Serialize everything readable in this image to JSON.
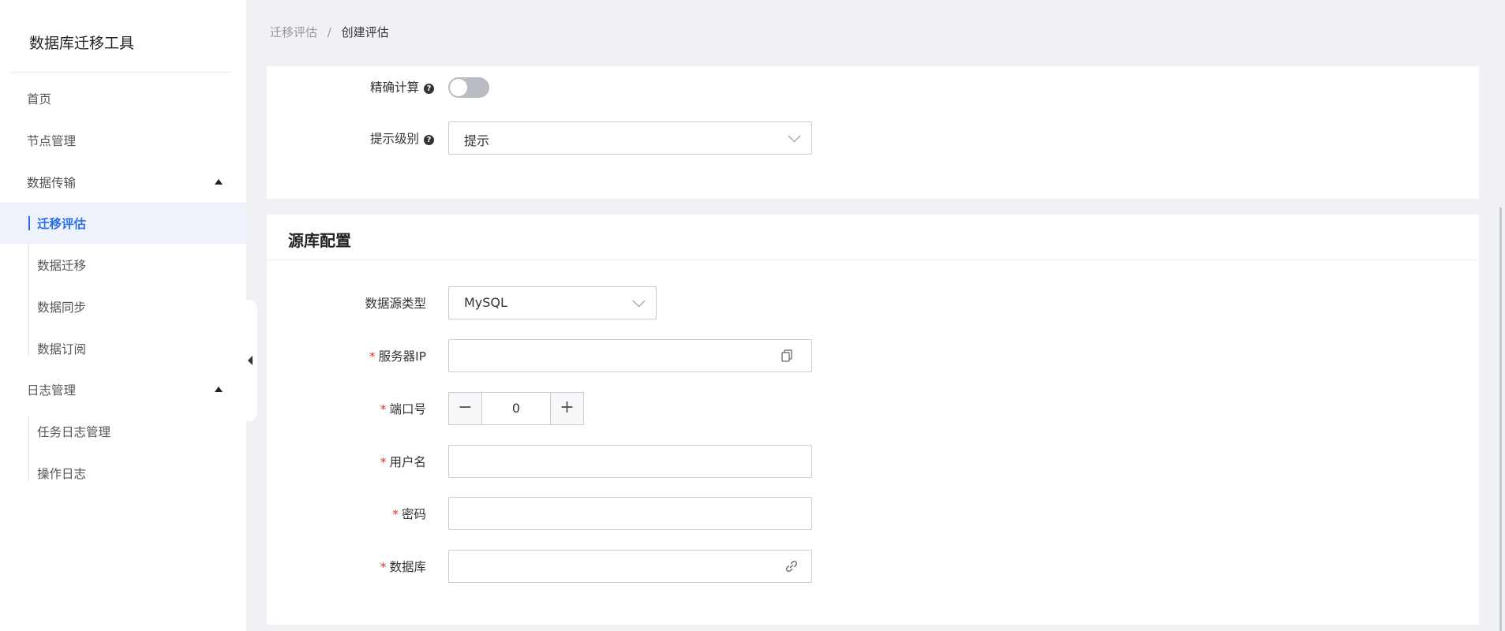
{
  "app": {
    "title": "数据库迁移工具"
  },
  "sidebar": {
    "items": [
      {
        "label": "首页"
      },
      {
        "label": "节点管理"
      },
      {
        "label": "数据传输"
      },
      {
        "label": "迁移评估"
      },
      {
        "label": "数据迁移"
      },
      {
        "label": "数据同步"
      },
      {
        "label": "数据订阅"
      },
      {
        "label": "日志管理"
      },
      {
        "label": "任务日志管理"
      },
      {
        "label": "操作日志"
      }
    ],
    "active": "迁移评估"
  },
  "breadcrumb": {
    "parent": "迁移评估",
    "separator": "/",
    "current": "创建评估"
  },
  "assessment": {
    "precise_calc_label": "精确计算",
    "precise_calc_on": false,
    "hint_level_label": "提示级别",
    "hint_level_value": "提示"
  },
  "source": {
    "title": "源库配置",
    "type_label": "数据源类型",
    "type_value": "MySQL",
    "ip_label": "服务器IP",
    "ip_value": "",
    "port_label": "端口号",
    "port_value": "0",
    "port_minus": "−",
    "port_plus": "+",
    "user_label": "用户名",
    "user_value": "",
    "password_label": "密码",
    "password_value": "",
    "database_label": "数据库",
    "database_value": ""
  },
  "icons": {
    "help": "question-circle-icon",
    "collapse": "caret-left-icon",
    "copy": "copy-icon",
    "link": "link-icon"
  },
  "colors": {
    "accent": "#2b6de5",
    "required": "#e0332f"
  }
}
